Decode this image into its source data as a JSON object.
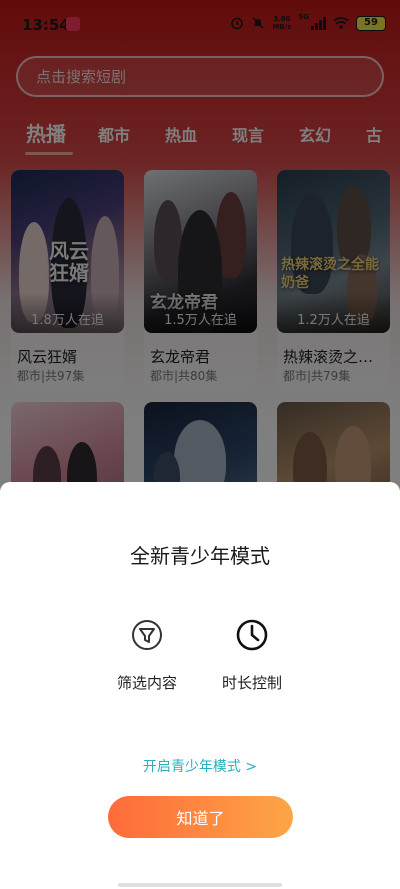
{
  "status_bar": {
    "time": "13:54",
    "net_speed_value": "3.80",
    "net_speed_unit": "MB/s",
    "signal_label": "5G",
    "battery": "59"
  },
  "search": {
    "placeholder": "点击搜索短剧"
  },
  "tabs": [
    {
      "label": "热播",
      "active": true
    },
    {
      "label": "都市",
      "active": false
    },
    {
      "label": "热血",
      "active": false
    },
    {
      "label": "现言",
      "active": false
    },
    {
      "label": "玄幻",
      "active": false
    },
    {
      "label": "古",
      "active": false
    }
  ],
  "dramas": [
    {
      "title": "风云狂婿",
      "poster_text": "风云狂婿",
      "views": "1.8万人在追",
      "meta": "都市|共97集"
    },
    {
      "title": "玄龙帝君",
      "poster_text": "玄龙帝君",
      "views": "1.5万人在追",
      "meta": "都市|共80集"
    },
    {
      "title": "热辣滚烫之…",
      "poster_text": "热辣滚烫之全能奶爸",
      "views": "1.2万人在追",
      "meta": "都市|共79集"
    }
  ],
  "teen_mode_sheet": {
    "title": "全新青少年模式",
    "features": [
      {
        "label": "筛选内容",
        "icon": "filter-icon"
      },
      {
        "label": "时长控制",
        "icon": "clock-icon"
      }
    ],
    "enable_link": "开启青少年模式 >",
    "ok_button": "知道了"
  },
  "colors": {
    "header_red": "#c61616",
    "link_teal": "#24b3bd",
    "button_gradient_start": "#ff6a3a",
    "button_gradient_end": "#fda646"
  }
}
